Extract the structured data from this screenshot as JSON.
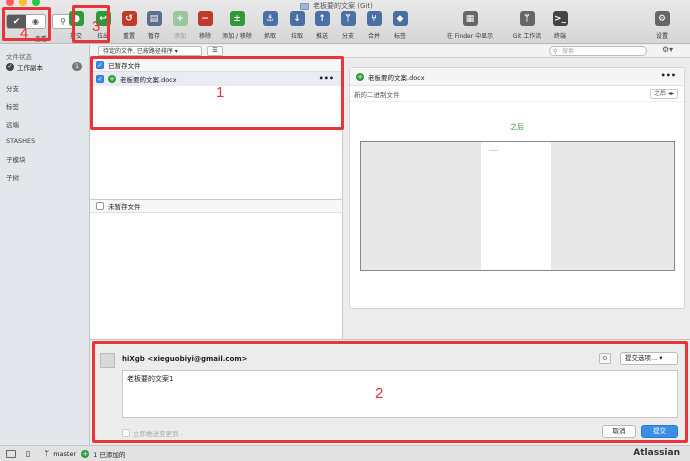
{
  "window": {
    "title": "老板要的文案 (Git)",
    "traffic": {
      "close": "#fe5f57",
      "min": "#febc2e",
      "max": "#28c840"
    }
  },
  "toolbar": {
    "view_label": "查看",
    "buttons": [
      {
        "label": "提交",
        "color": "#2e9a3c",
        "icon": "commit-icon",
        "glyph": "●"
      },
      {
        "label": "拉出",
        "color": "#2e9a3c",
        "icon": "checkout-icon",
        "glyph": "↩"
      },
      {
        "label": "重置",
        "color": "#c0392b",
        "icon": "reset-icon",
        "glyph": "↺"
      },
      {
        "label": "暂存",
        "color": "#5b6f8a",
        "icon": "stash-icon",
        "glyph": "▤"
      },
      {
        "label": "添加",
        "color": "#9ac7a0",
        "icon": "add-icon",
        "glyph": "+"
      },
      {
        "label": "移除",
        "color": "#c0392b",
        "icon": "remove-icon",
        "glyph": "−"
      },
      {
        "label": "添加 / 移除",
        "color": "#2e9a3c",
        "icon": "add-remove-icon",
        "glyph": "±"
      },
      {
        "label": "抓取",
        "color": "#4a6fa5",
        "icon": "fetch-icon",
        "glyph": "⚓"
      },
      {
        "label": "拉取",
        "color": "#4a6fa5",
        "icon": "pull-icon",
        "glyph": "↓"
      },
      {
        "label": "推送",
        "color": "#4a6fa5",
        "icon": "push-icon",
        "glyph": "↑"
      },
      {
        "label": "分支",
        "color": "#4a6fa5",
        "icon": "branch-icon",
        "glyph": "ᛘ"
      },
      {
        "label": "合并",
        "color": "#4a6fa5",
        "icon": "merge-icon",
        "glyph": "⑂"
      },
      {
        "label": "标签",
        "color": "#4a6fa5",
        "icon": "tag-icon",
        "glyph": "◆"
      },
      {
        "label": "在 Finder 中显示",
        "color": "#666666",
        "icon": "finder-icon",
        "glyph": "▦"
      },
      {
        "label": "Git 工作流",
        "color": "#666666",
        "icon": "gitflow-icon",
        "glyph": "ᛘ"
      },
      {
        "label": "终端",
        "color": "#444444",
        "icon": "terminal-icon",
        "glyph": ">_"
      },
      {
        "label": "设置",
        "color": "#666666",
        "icon": "settings-icon",
        "glyph": "⚙"
      }
    ]
  },
  "filterbar": {
    "sort_select": "待定的文件, 已按路径排序",
    "search_placeholder": "搜索"
  },
  "sidebar": {
    "file_status_header": "文件状态",
    "working_copy": "工作副本",
    "working_copy_count": "1",
    "branches": "分支",
    "tags": "标签",
    "remotes": "远端",
    "stashes": "STASHES",
    "submodules": "子模块",
    "subtrees": "子树"
  },
  "staged": {
    "header": "已暂存文件",
    "files": [
      {
        "name": "老板要的文案.docx"
      }
    ]
  },
  "unstaged": {
    "header": "未暂存文件"
  },
  "preview": {
    "filename": "老板要的文案.docx",
    "subtitle": "新的二进制文件",
    "select": "之后",
    "after_label": "之后",
    "doc_text": "-----"
  },
  "commit": {
    "author": "hiXgb <xieguobiyi@gmail.com>",
    "options": "提交选项...",
    "message": "老板要的文案1",
    "push_label": "立即推送变更到 -",
    "cancel": "取消",
    "submit": "提交"
  },
  "status": {
    "branch": "master",
    "added": "1 已添加的"
  },
  "brand": "Atlassian",
  "annotations": [
    "1",
    "2",
    "3",
    "4"
  ]
}
